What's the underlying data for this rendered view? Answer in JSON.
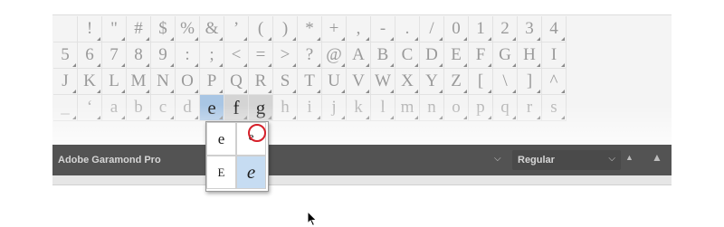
{
  "glyph_rows": [
    [
      " ",
      "!",
      "\"",
      "#",
      "$",
      "%",
      "&",
      "’",
      "(",
      ")",
      "*",
      "+",
      ",",
      "-",
      ".",
      "/",
      "0",
      "1",
      "2",
      "3",
      "4"
    ],
    [
      "5",
      "6",
      "7",
      "8",
      "9",
      ":",
      ";",
      "<",
      "=",
      ">",
      "?",
      "@",
      "A",
      "B",
      "C",
      "D",
      "E",
      "F",
      "G",
      "H",
      "I"
    ],
    [
      "J",
      "K",
      "L",
      "M",
      "N",
      "O",
      "P",
      "Q",
      "R",
      "S",
      "T",
      "U",
      "V",
      "W",
      "X",
      "Y",
      "Z",
      "[",
      "\\",
      "]",
      "^"
    ],
    [
      "_",
      "‘",
      "a",
      "b",
      "c",
      "d",
      "e",
      "f",
      "g",
      "h",
      "i",
      "j",
      "k",
      "l",
      "m",
      "n",
      "o",
      "p",
      "q",
      "r",
      "s"
    ]
  ],
  "toolbar": {
    "font_family": "Adobe Garamond Pro",
    "font_style": "Regular",
    "dropdown_caret": "⌵",
    "zoom_out_icon": "▲",
    "zoom_in_icon": "▲"
  },
  "alternates": [
    "e",
    "e",
    "E",
    "e"
  ],
  "colors": {
    "selected": "#a9c6e4",
    "toolbar": "#535353",
    "highlight_ring": "#d6202a"
  }
}
